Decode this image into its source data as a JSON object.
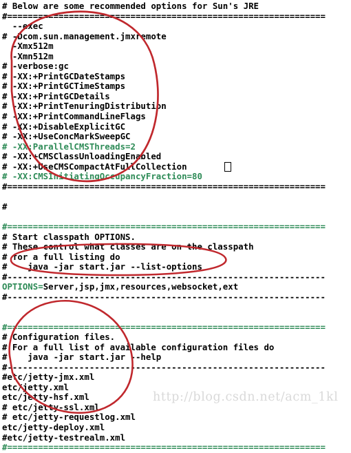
{
  "editor": {
    "background_color": "#ffffff",
    "text_color": "#000000",
    "highlight_color": "#2e8b57",
    "annotation_color": "#c0282d",
    "watermark_color": "#d9d9d9"
  },
  "lines": [
    {
      "text": "# Below are some recommended options for Sun's JRE",
      "style": "normal"
    },
    {
      "text": "#==============================================================",
      "style": "normal"
    },
    {
      "text": "  --exec",
      "style": "normal"
    },
    {
      "text": "# -Dcom.sun.management.jmxremote",
      "style": "normal"
    },
    {
      "text": "  -Xmx512m",
      "style": "normal"
    },
    {
      "text": "  -Xmn512m",
      "style": "normal"
    },
    {
      "text": "# -verbose:gc",
      "style": "normal"
    },
    {
      "text": "# -XX:+PrintGCDateStamps",
      "style": "normal"
    },
    {
      "text": "# -XX:+PrintGCTimeStamps",
      "style": "normal"
    },
    {
      "text": "# -XX:+PrintGCDetails",
      "style": "normal"
    },
    {
      "text": "# -XX:+PrintTenuringDistribution",
      "style": "normal"
    },
    {
      "text": "# -XX:+PrintCommandLineFlags",
      "style": "normal"
    },
    {
      "text": "# -XX:+DisableExplicitGC",
      "style": "normal"
    },
    {
      "text": "# -XX:+UseConcMarkSweepGC",
      "style": "normal"
    },
    {
      "text": "# -XX:ParallelCMSThreads=2",
      "style": "green"
    },
    {
      "text": "# -XX:+CMSClassUnloadingEnabled",
      "style": "normal"
    },
    {
      "text": "# -XX:+UseCMSCompactAtFullCollection",
      "style": "normal"
    },
    {
      "text": "# -XX:CMSInitiatingOccupancyFraction=80",
      "style": "green"
    },
    {
      "text": "#==============================================================",
      "style": "normal"
    },
    {
      "text": "",
      "style": "blank"
    },
    {
      "text": "#",
      "style": "normal"
    },
    {
      "text": "",
      "style": "blank"
    },
    {
      "text": "#==============================================================",
      "style": "green"
    },
    {
      "text": "# Start classpath OPTIONS.",
      "style": "normal"
    },
    {
      "text": "# These control what classes are on the classpath",
      "style": "normal"
    },
    {
      "text": "# for a full listing do",
      "style": "normal"
    },
    {
      "text": "#    java -jar start.jar --list-options",
      "style": "normal"
    },
    {
      "text": "#--------------------------------------------------------------",
      "style": "normal"
    },
    {
      "text": "OPTIONS=Server,jsp,jmx,resources,websocket,ext",
      "style": "green-prefix"
    },
    {
      "text": "#--------------------------------------------------------------",
      "style": "normal"
    },
    {
      "text": "",
      "style": "blank"
    },
    {
      "text": "",
      "style": "blank"
    },
    {
      "text": "#==============================================================",
      "style": "green"
    },
    {
      "text": "# Configuration files.",
      "style": "normal"
    },
    {
      "text": "# For a full list of available configuration files do",
      "style": "normal"
    },
    {
      "text": "#    java -jar start.jar --help",
      "style": "normal"
    },
    {
      "text": "#--------------------------------------------------------------",
      "style": "normal"
    },
    {
      "text": "#etc/jetty-jmx.xml",
      "style": "normal"
    },
    {
      "text": "etc/jetty.xml",
      "style": "normal"
    },
    {
      "text": "etc/jetty-hsf.xml",
      "style": "normal"
    },
    {
      "text": "# etc/jetty-ssl.xml",
      "style": "normal"
    },
    {
      "text": "# etc/jetty-requestlog.xml",
      "style": "normal"
    },
    {
      "text": "etc/jetty-deploy.xml",
      "style": "normal"
    },
    {
      "text": "#etc/jetty-testrealm.xml",
      "style": "normal"
    },
    {
      "text": "#==============================================================",
      "style": "green"
    }
  ],
  "options_line": {
    "key": "OPTIONS",
    "separator": "=",
    "value": "Server,jsp,jmx,resources,websocket,ext"
  },
  "cursor": {
    "line_index": 16,
    "column": 33,
    "char": "n"
  },
  "watermark": {
    "text": "http://blog.csdn.net/acm_1kl"
  },
  "annotations": [
    {
      "name": "red-ellipse-jvm-options",
      "shape": "ellipse"
    },
    {
      "name": "red-ellipse-options-line",
      "shape": "ellipse"
    },
    {
      "name": "red-ellipse-config-files",
      "shape": "ellipse"
    }
  ]
}
